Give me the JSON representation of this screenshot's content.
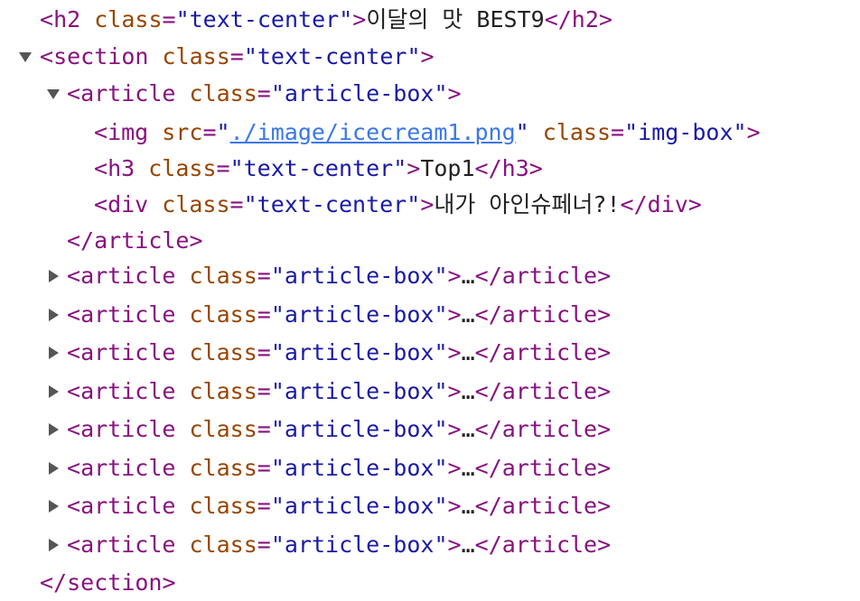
{
  "nodes": {
    "h2": {
      "tag": "h2",
      "attr": "class",
      "value": "text-center",
      "text": "이달의 맛 BEST9"
    },
    "section": {
      "tag": "section",
      "attr": "class",
      "value": "text-center",
      "expanded": true
    },
    "article1": {
      "tag": "article",
      "attr": "class",
      "value": "article-box",
      "expanded": true
    },
    "img": {
      "tag": "img",
      "attr1": "src",
      "value1": "./image/icecream1.png",
      "attr2": "class",
      "value2": "img-box"
    },
    "h3": {
      "tag": "h3",
      "attr": "class",
      "value": "text-center",
      "text": "Top1"
    },
    "div": {
      "tag": "div",
      "attr": "class",
      "value": "text-center",
      "text": "내가 아인슈페너?!"
    },
    "article1_close": "article",
    "collapsed_articles": [
      {
        "tag": "article",
        "attr": "class",
        "value": "article-box",
        "ellipsis": "…"
      },
      {
        "tag": "article",
        "attr": "class",
        "value": "article-box",
        "ellipsis": "…"
      },
      {
        "tag": "article",
        "attr": "class",
        "value": "article-box",
        "ellipsis": "…"
      },
      {
        "tag": "article",
        "attr": "class",
        "value": "article-box",
        "ellipsis": "…"
      },
      {
        "tag": "article",
        "attr": "class",
        "value": "article-box",
        "ellipsis": "…"
      },
      {
        "tag": "article",
        "attr": "class",
        "value": "article-box",
        "ellipsis": "…"
      },
      {
        "tag": "article",
        "attr": "class",
        "value": "article-box",
        "ellipsis": "…"
      },
      {
        "tag": "article",
        "attr": "class",
        "value": "article-box",
        "ellipsis": "…"
      }
    ],
    "section_close": "section"
  },
  "colors": {
    "tag": "#881280",
    "attribute": "#994500",
    "value": "#1a1aa6",
    "link": "#3b78e7",
    "text": "#222222"
  },
  "icons": {
    "expanded": "triangle-down-icon",
    "collapsed": "triangle-right-icon"
  }
}
